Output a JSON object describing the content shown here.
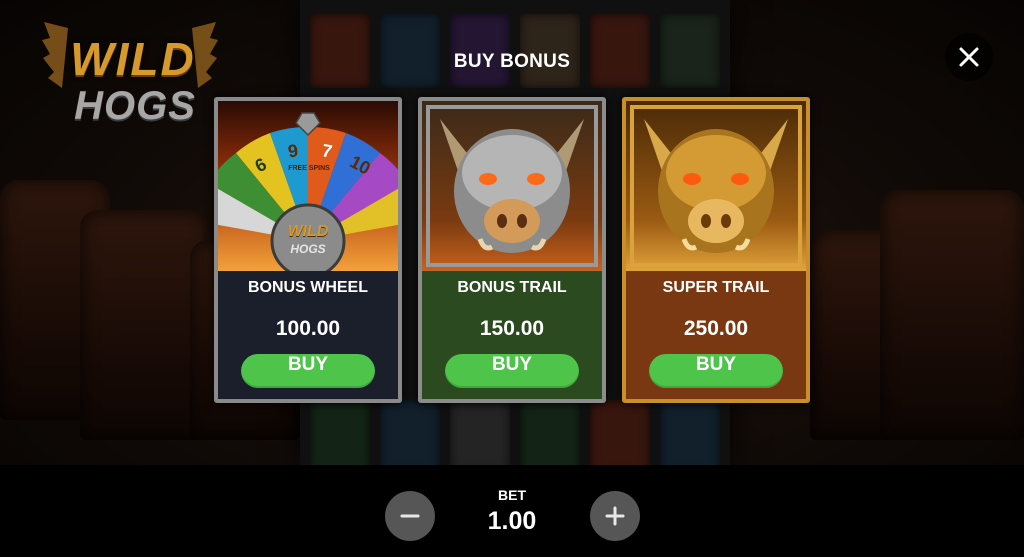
{
  "game": {
    "logo_top": "WILD",
    "logo_bottom": "HOGS"
  },
  "dialog": {
    "title": "BUY BONUS"
  },
  "options": [
    {
      "name": "BONUS WHEEL",
      "price": "100.00",
      "buy_label": "BUY"
    },
    {
      "name": "BONUS TRAIL",
      "price": "150.00",
      "buy_label": "BUY"
    },
    {
      "name": "SUPER TRAIL",
      "price": "250.00",
      "buy_label": "BUY"
    }
  ],
  "wheel": {
    "numbers": [
      "6",
      "9",
      "7",
      "10"
    ],
    "segment_label": "FREE SPINS",
    "center_top": "WILD",
    "center_bottom": "HOGS"
  },
  "bet": {
    "label": "BET",
    "value": "1.00"
  },
  "icons": {
    "close": "close-icon",
    "minus": "minus-icon",
    "plus": "plus-icon"
  },
  "colors": {
    "buy_button": "#4ec44a",
    "wheel_panel": "#1b1f2c",
    "trail_panel": "#2c4a1f",
    "super_panel": "#7a3812"
  }
}
